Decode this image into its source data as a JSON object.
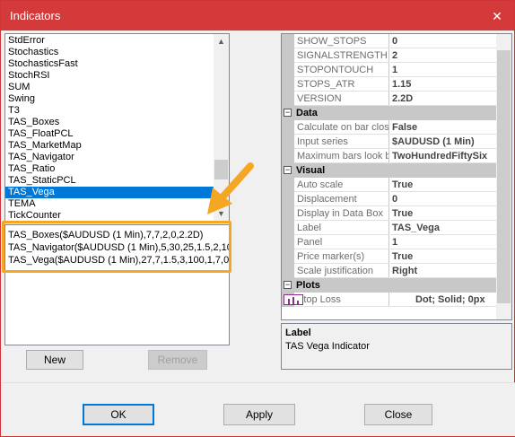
{
  "window": {
    "title": "Indicators",
    "close_glyph": "✕"
  },
  "indicator_list": {
    "items": [
      "StdError",
      "Stochastics",
      "StochasticsFast",
      "StochRSI",
      "SUM",
      "Swing",
      "T3",
      "TAS_Boxes",
      "TAS_FloatPCL",
      "TAS_MarketMap",
      "TAS_Navigator",
      "TAS_Ratio",
      "TAS_StaticPCL",
      "TAS_Vega",
      "TEMA",
      "TickCounter"
    ],
    "selected": "TAS_Vega"
  },
  "applied": {
    "items": [
      "TAS_Boxes($AUDUSD (1 Min),7,7,2,0,2.2D)",
      "TAS_Navigator($AUDUSD (1 Min),5,30,25,1.5,2,10",
      "TAS_Vega($AUDUSD (1 Min),27,7,1.5,3,100,1,7,0,"
    ]
  },
  "buttons": {
    "new": "New",
    "remove": "Remove",
    "ok": "OK",
    "apply": "Apply",
    "close": "Close"
  },
  "properties": {
    "top_rows": [
      {
        "name": "SHOW_STOPS",
        "value": "0"
      },
      {
        "name": "SIGNALSTRENGTH",
        "value": "2"
      },
      {
        "name": "STOPONTOUCH",
        "value": "1"
      },
      {
        "name": "STOPS_ATR",
        "value": "1.15"
      },
      {
        "name": "VERSION",
        "value": "2.2D"
      }
    ],
    "data_cat": "Data",
    "data_rows": [
      {
        "name": "Calculate on bar clos",
        "value": "False"
      },
      {
        "name": "Input series",
        "value": "$AUDUSD (1 Min)"
      },
      {
        "name": "Maximum bars look b",
        "value": "TwoHundredFiftySix"
      }
    ],
    "visual_cat": "Visual",
    "visual_rows": [
      {
        "name": "Auto scale",
        "value": "True"
      },
      {
        "name": "Displacement",
        "value": "0"
      },
      {
        "name": "Display in Data Box",
        "value": "True"
      },
      {
        "name": "Label",
        "value": "TAS_Vega"
      },
      {
        "name": "Panel",
        "value": "1"
      },
      {
        "name": "Price marker(s)",
        "value": "True"
      },
      {
        "name": "Scale justification",
        "value": "Right"
      }
    ],
    "plots_cat": "Plots",
    "plots_rows": [
      {
        "name": "Stop Loss",
        "value": "Dot; Solid; 0px"
      }
    ],
    "toggle_collapse": "−",
    "toggle_expand": "+"
  },
  "description": {
    "label": "Label",
    "text": "TAS Vega Indicator"
  },
  "colors": {
    "title_bar": "#d43a3a",
    "selection": "#0078d7",
    "highlight": "#f5a623"
  }
}
